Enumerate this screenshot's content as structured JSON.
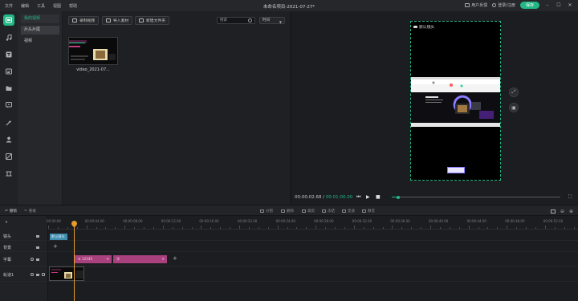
{
  "menu": [
    "文件",
    "编辑",
    "工具",
    "视图",
    "帮助"
  ],
  "window_title": "未命名项目-2021-07-27*",
  "title_right": {
    "feedback": "用户反馈",
    "login": "登录/注册",
    "save": "保存"
  },
  "rail_icons": [
    "media-library-icon",
    "music-icon",
    "text-icon",
    "subtitle-icon",
    "folder-icon",
    "comment-icon",
    "magic-wand-icon",
    "person-icon",
    "filter-icon",
    "transition-icon"
  ],
  "categories": [
    "我的视频",
    "片头片尾",
    "视频"
  ],
  "library": {
    "record_label": "录制视频",
    "import_label": "导入素材",
    "new_folder_label": "新建文件夹",
    "search_placeholder": "搜索",
    "sort_value": "时间",
    "thumbnail_label": "video_2021-07..."
  },
  "preview": {
    "canvas_label": "默认镜头",
    "current_time": "00:00:02.68",
    "separator": " / ",
    "total_time": "00:01:00.00",
    "progress": 0.04
  },
  "toolbar": {
    "undo": "撤销",
    "redo": "重做",
    "split": "分割",
    "delete": "删除",
    "trim": "裁剪",
    "freeze": "冻结",
    "speed": "变速",
    "crop": "裁剪",
    "mute": "静音"
  },
  "timeline": {
    "ruler_ticks": [
      "00:00:00",
      "00:00:04.00",
      "00:00:08.00",
      "00:00:12.00",
      "00:00:16.00",
      "00:00:20.00",
      "00:00:24.00",
      "00:00:28.00",
      "00:00:32.00",
      "00:00:36.00",
      "00:00:40.00",
      "00:00:44.00",
      "00:00:48.00",
      "00:00:52.00"
    ],
    "tracks": [
      {
        "name": "镜头"
      },
      {
        "name": "背景"
      },
      {
        "name": "字幕"
      },
      {
        "name": "轨道1"
      }
    ],
    "camera_clip_label": "默认镜头",
    "subtitle_clip_1": "12345",
    "subtitle_clip_2": "字"
  },
  "colors": {
    "accent": "#22b784",
    "subtitle_clip": "#a8417d",
    "camera_clip": "#3f8dae",
    "playhead": "#e79b2a"
  }
}
